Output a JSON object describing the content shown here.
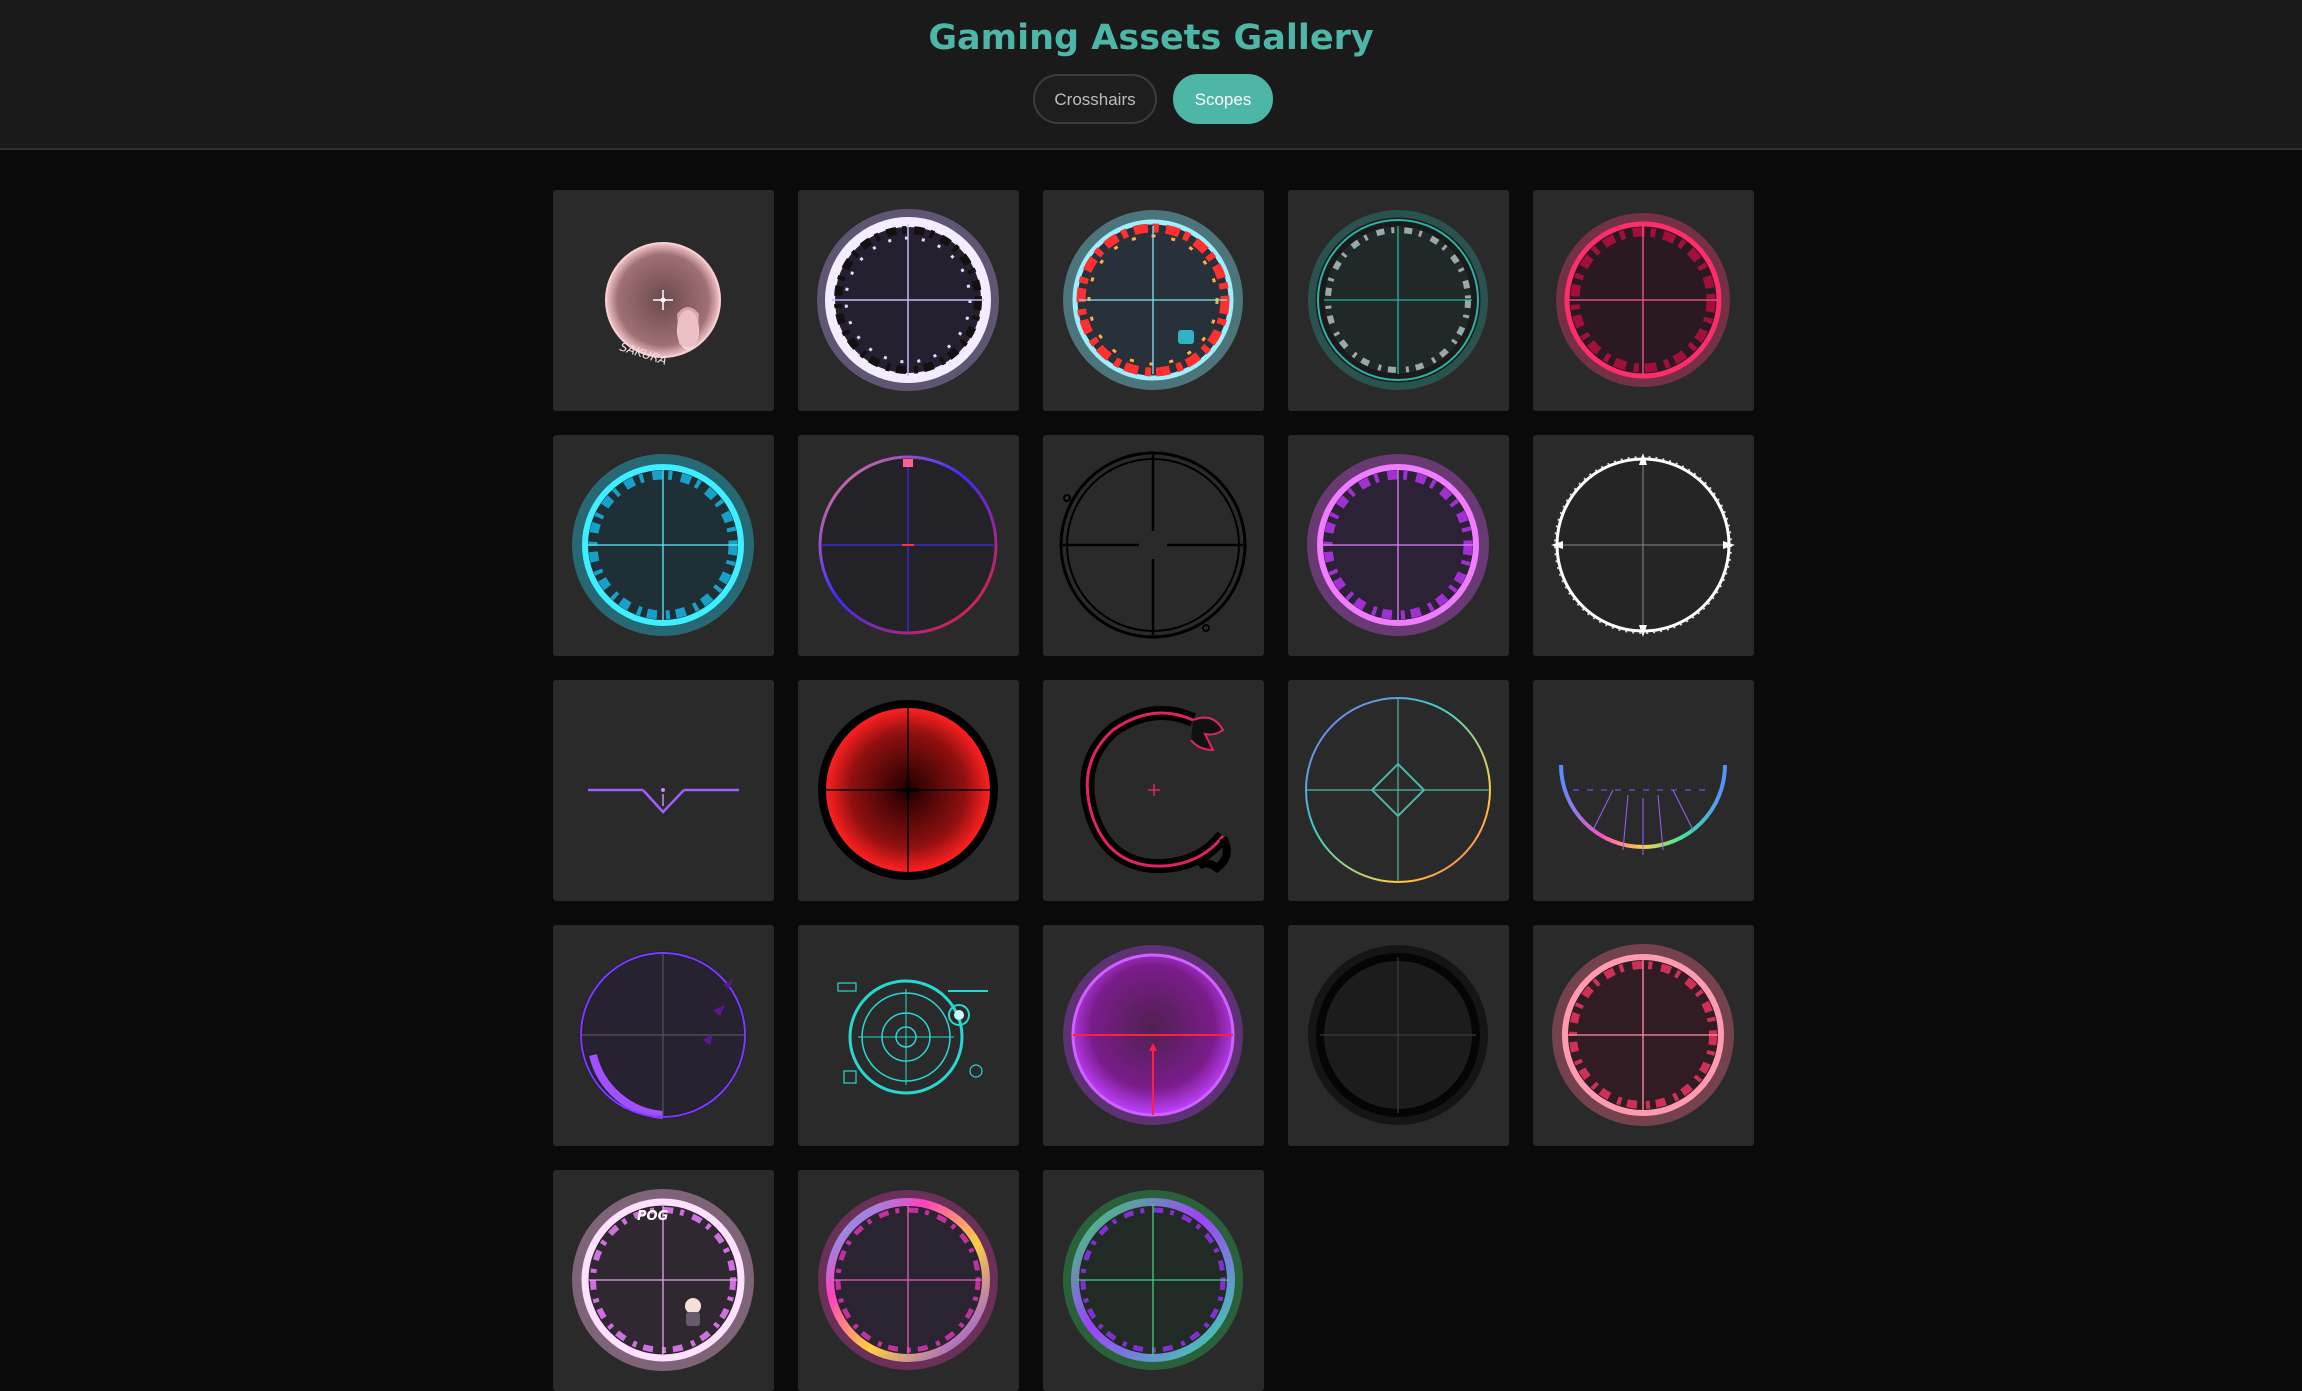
{
  "header": {
    "title": "Gaming Assets Gallery",
    "tabs": [
      {
        "label": "Crosshairs",
        "active": false
      },
      {
        "label": "Scopes",
        "active": true
      }
    ]
  },
  "colors": {
    "accent": "#4db6a7",
    "page_background": "#0a0a0a",
    "header_background": "#1a1a1a",
    "card_background": "#2a2a2a"
  },
  "gallery": {
    "item_count": 23,
    "items": [
      {
        "icon": "anime-girl-scope-icon",
        "glow": "#f3c4c8"
      },
      {
        "icon": "white-purple-flame-scope-icon",
        "glow": "#c9a6ff"
      },
      {
        "icon": "red-cyan-flame-scope-icon",
        "glow": "#7fe6f5"
      },
      {
        "icon": "teal-dark-scope-icon",
        "glow": "#2bb3a6"
      },
      {
        "icon": "crimson-flame-scope-icon",
        "glow": "#ff3b78"
      },
      {
        "icon": "cyan-flame-scope-icon",
        "glow": "#1fe0ff"
      },
      {
        "icon": "red-blue-scope-icon",
        "glow": "#4b3cff"
      },
      {
        "icon": "black-tactical-scope-icon",
        "glow": "#000000"
      },
      {
        "icon": "magenta-flame-scope-icon",
        "glow": "#e055ff"
      },
      {
        "icon": "white-spiky-scope-icon",
        "glow": "#ffffff"
      },
      {
        "icon": "purple-v-sight-icon",
        "glow": "#a25cff"
      },
      {
        "icon": "red-black-scope-icon",
        "glow": "#e01818"
      },
      {
        "icon": "dragon-scope-icon",
        "glow": "#e0245e"
      },
      {
        "icon": "rainbow-diamond-scope-icon",
        "glow": "#8ad"
      },
      {
        "icon": "rainbow-arc-sight-icon",
        "glow": "#5a8cff"
      },
      {
        "icon": "purple-bats-scope-icon",
        "glow": "#8a3cff"
      },
      {
        "icon": "cyan-hud-scope-icon",
        "glow": "#28d8d0"
      },
      {
        "icon": "purple-red-orb-scope-icon",
        "glow": "#c040ff"
      },
      {
        "icon": "shadow-scope-icon",
        "glow": "#000000"
      },
      {
        "icon": "pink-flame-scope-icon",
        "glow": "#ff7090"
      },
      {
        "icon": "pog-pink-scope-icon",
        "glow": "#ffb8f0",
        "text": "POG"
      },
      {
        "icon": "rainbow-flame-scope-icon",
        "glow": "#ff40c0"
      },
      {
        "icon": "green-purple-flame-scope-icon",
        "glow": "#30e060"
      }
    ]
  }
}
